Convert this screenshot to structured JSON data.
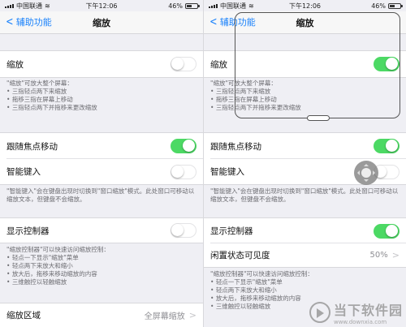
{
  "status": {
    "carrier": "中国联通",
    "time": "下午12:06",
    "battery_percent_label": "46%",
    "battery_level": 0.46
  },
  "nav": {
    "back_label": "辅助功能",
    "title": "缩放"
  },
  "left": {
    "zoom_label": "缩放",
    "zoom_on": false,
    "zoom_footer_intro": "\"缩放\"可放大整个屏幕：",
    "zoom_footer_items": [
      "三指轻点两下来缩放",
      "拖移三指在屏幕上移动",
      "三指轻点两下并拖移来更改缩放"
    ],
    "follow_focus_label": "跟随焦点移动",
    "follow_focus_on": true,
    "smart_typing_label": "智能键入",
    "smart_typing_on": false,
    "smart_typing_footer": "\"智能键入\"会在键盘出现时切换到\"窗口缩放\"模式。此处窗口可移动以缩放文本，但键盘不会缩放。",
    "show_controller_label": "显示控制器",
    "show_controller_on": false,
    "controller_footer_intro": "\"缩放控制器\"可以快速访问缩放控制：",
    "controller_footer_items": [
      "轻点一下显示\"缩放\"菜单",
      "轻点两下来放大和缩小",
      "放大后，拖移来移动缩放的内容",
      "三维触控以轻触缩放"
    ],
    "zoom_region_label": "缩放区域",
    "zoom_region_value": "全屏幕缩放"
  },
  "right": {
    "zoom_label": "缩放",
    "zoom_on": true,
    "zoom_footer_intro": "\"缩放\"可放大整个屏幕：",
    "zoom_footer_items": [
      "三指轻点两下来缩放",
      "拖移三指在屏幕上移动",
      "三指轻点两下并拖移来更改缩放"
    ],
    "follow_focus_label": "跟随焦点移动",
    "follow_focus_on": true,
    "smart_typing_label": "智能键入",
    "smart_typing_on": false,
    "smart_typing_footer": "\"智能键入\"会在键盘出现时切换到\"窗口缩放\"模式。此处窗口可移动以缩放文本，但键盘不会缩放。",
    "show_controller_label": "显示控制器",
    "show_controller_on": true,
    "idle_visibility_label": "闲置状态可见度",
    "idle_visibility_value": "50%",
    "controller_footer_intro": "\"缩放控制器\"可以快速访问缩放控制：",
    "controller_footer_items": [
      "轻点一下显示\"缩放\"菜单",
      "轻点两下来放大和缩小",
      "放大后，拖移来移动缩放的内容",
      "三维触控以轻触缩放"
    ]
  },
  "watermark": {
    "name": "当下软件园",
    "url": "www.downxia.com"
  },
  "icons": {
    "back": "chevron-left-icon",
    "disclosure": "chevron-right-icon",
    "wifi": "wifi-icon",
    "battery": "battery-icon",
    "signal": "signal-icon"
  },
  "colors": {
    "accent_blue": "#1a82fb",
    "toggle_on": "#4cd964",
    "background": "#efeff4"
  }
}
